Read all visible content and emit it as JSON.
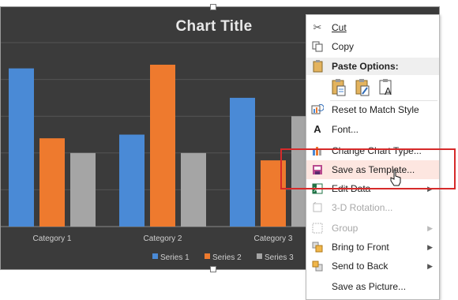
{
  "chart": {
    "title": "Chart Title",
    "colors": {
      "background": "#3b3b3b",
      "series1": "#4a8ad6",
      "series2": "#ee7a2e",
      "series3": "#a5a5a5"
    }
  },
  "chart_data": {
    "type": "bar",
    "title": "Chart Title",
    "categories": [
      "Category 1",
      "Category 2",
      "Category 3"
    ],
    "series": [
      {
        "name": "Series 1",
        "values": [
          4.3,
          2.5,
          3.5
        ]
      },
      {
        "name": "Series 2",
        "values": [
          2.4,
          4.4,
          1.8
        ]
      },
      {
        "name": "Series 3",
        "values": [
          2.0,
          2.0,
          3.0
        ]
      }
    ],
    "ylim": [
      0,
      5
    ],
    "grid": true,
    "legend": "bottom"
  },
  "menu": {
    "cut": "Cut",
    "copy": "Copy",
    "paste_options": "Paste Options:",
    "reset": "Reset to Match Style",
    "font": "Font...",
    "change_type": "Change Chart Type...",
    "save_template": "Save as Template...",
    "edit_data": "Edit Data",
    "rotation": "3-D Rotation...",
    "group": "Group",
    "bring_front": "Bring to Front",
    "send_back": "Send to Back",
    "save_picture": "Save as Picture..."
  }
}
